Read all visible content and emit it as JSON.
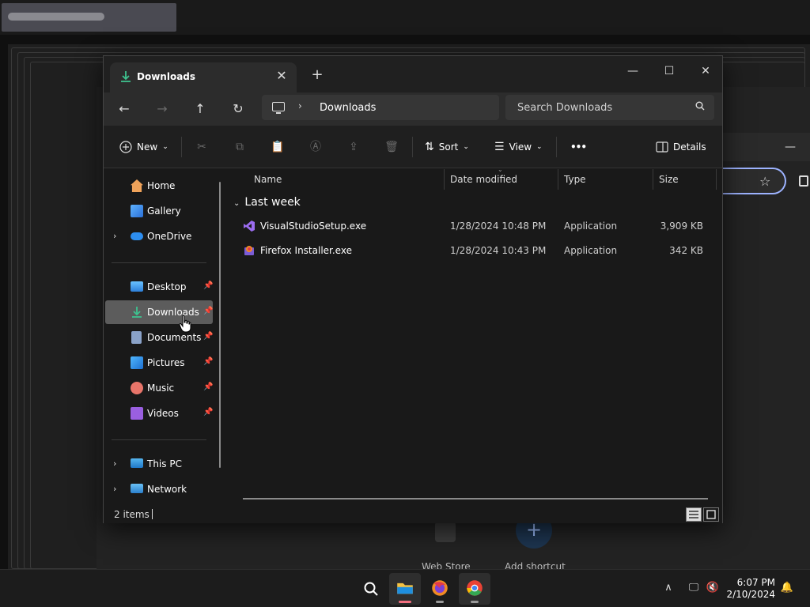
{
  "explorer": {
    "tab_title": "Downloads",
    "tab_close": "✕",
    "new_tab": "+",
    "window_controls": {
      "minimize": "—",
      "maximize": "☐",
      "close": "✕"
    },
    "nav": {
      "back": "←",
      "forward": "→",
      "up": "↑",
      "refresh": "↻"
    },
    "address": {
      "chevron": "›",
      "crumb": "Downloads"
    },
    "search_placeholder": "Search Downloads",
    "toolbar": {
      "new_label": "New",
      "sort_label": "Sort",
      "view_label": "View",
      "more_label": "•••",
      "details_label": "Details"
    },
    "sidebar": {
      "top": [
        {
          "label": "Home",
          "icon": "home-icon"
        },
        {
          "label": "Gallery",
          "icon": "gallery-icon"
        },
        {
          "label": "OneDrive",
          "icon": "cloud-icon"
        }
      ],
      "pinned": [
        {
          "label": "Desktop",
          "icon": "desktop-icon"
        },
        {
          "label": "Downloads",
          "icon": "download-icon"
        },
        {
          "label": "Documents",
          "icon": "documents-icon"
        },
        {
          "label": "Pictures",
          "icon": "pictures-icon"
        },
        {
          "label": "Music",
          "icon": "music-icon"
        },
        {
          "label": "Videos",
          "icon": "videos-icon"
        }
      ],
      "bottom": [
        {
          "label": "This PC",
          "icon": "computer-icon"
        },
        {
          "label": "Network",
          "icon": "network-icon"
        }
      ]
    },
    "columns": [
      "Name",
      "Date modified",
      "Type",
      "Size"
    ],
    "group_label": "Last week",
    "files": [
      {
        "name": "VisualStudioSetup.exe",
        "date": "1/28/2024 10:48 PM",
        "type": "Application",
        "size": "3,909 KB"
      },
      {
        "name": "Firefox Installer.exe",
        "date": "1/28/2024 10:43 PM",
        "type": "Application",
        "size": "342 KB"
      }
    ],
    "status_count": "2 items"
  },
  "background": {
    "web_store_label": "Web Store",
    "add_shortcut_label": "Add shortcut",
    "plus": "+"
  },
  "taskbar": {
    "time": "6:07 PM",
    "date": "2/10/2024"
  },
  "colors": {
    "accent_green": "#3ec28f",
    "selected_bg": "#5c5c5c",
    "window_bg": "#191919"
  }
}
